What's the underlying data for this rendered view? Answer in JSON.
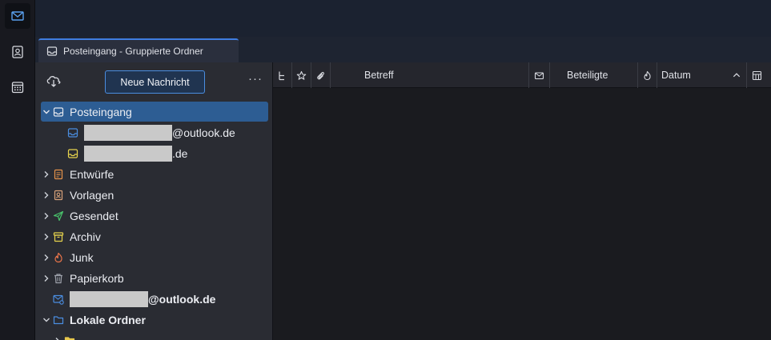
{
  "tab": {
    "title": "Posteingang - Gruppierte Ordner",
    "icon": "inbox-icon"
  },
  "spaces": [
    {
      "name": "mail-icon",
      "active": true
    },
    {
      "name": "address-book-icon",
      "active": false
    },
    {
      "name": "calendar-icon",
      "active": false
    }
  ],
  "folderpane": {
    "get_messages_icon": "cloud-download-icon",
    "new_message_label": "Neue Nachricht",
    "more_label": "···"
  },
  "folders": {
    "inbox": "Posteingang",
    "account1_suffix": "@outlook.de",
    "account2_suffix": ".de",
    "drafts": "Entwürfe",
    "templates": "Vorlagen",
    "sent": "Gesendet",
    "archive": "Archiv",
    "junk": "Junk",
    "trash": "Papierkorb",
    "account_suffix": "@outlook.de",
    "local_folders": "Lokale Ordner"
  },
  "columns": {
    "subject": "Betreff",
    "correspondents": "Beteiligte",
    "date": "Datum"
  },
  "colors": {
    "accent": "#4a8de0",
    "selected": "#2d5d93"
  }
}
